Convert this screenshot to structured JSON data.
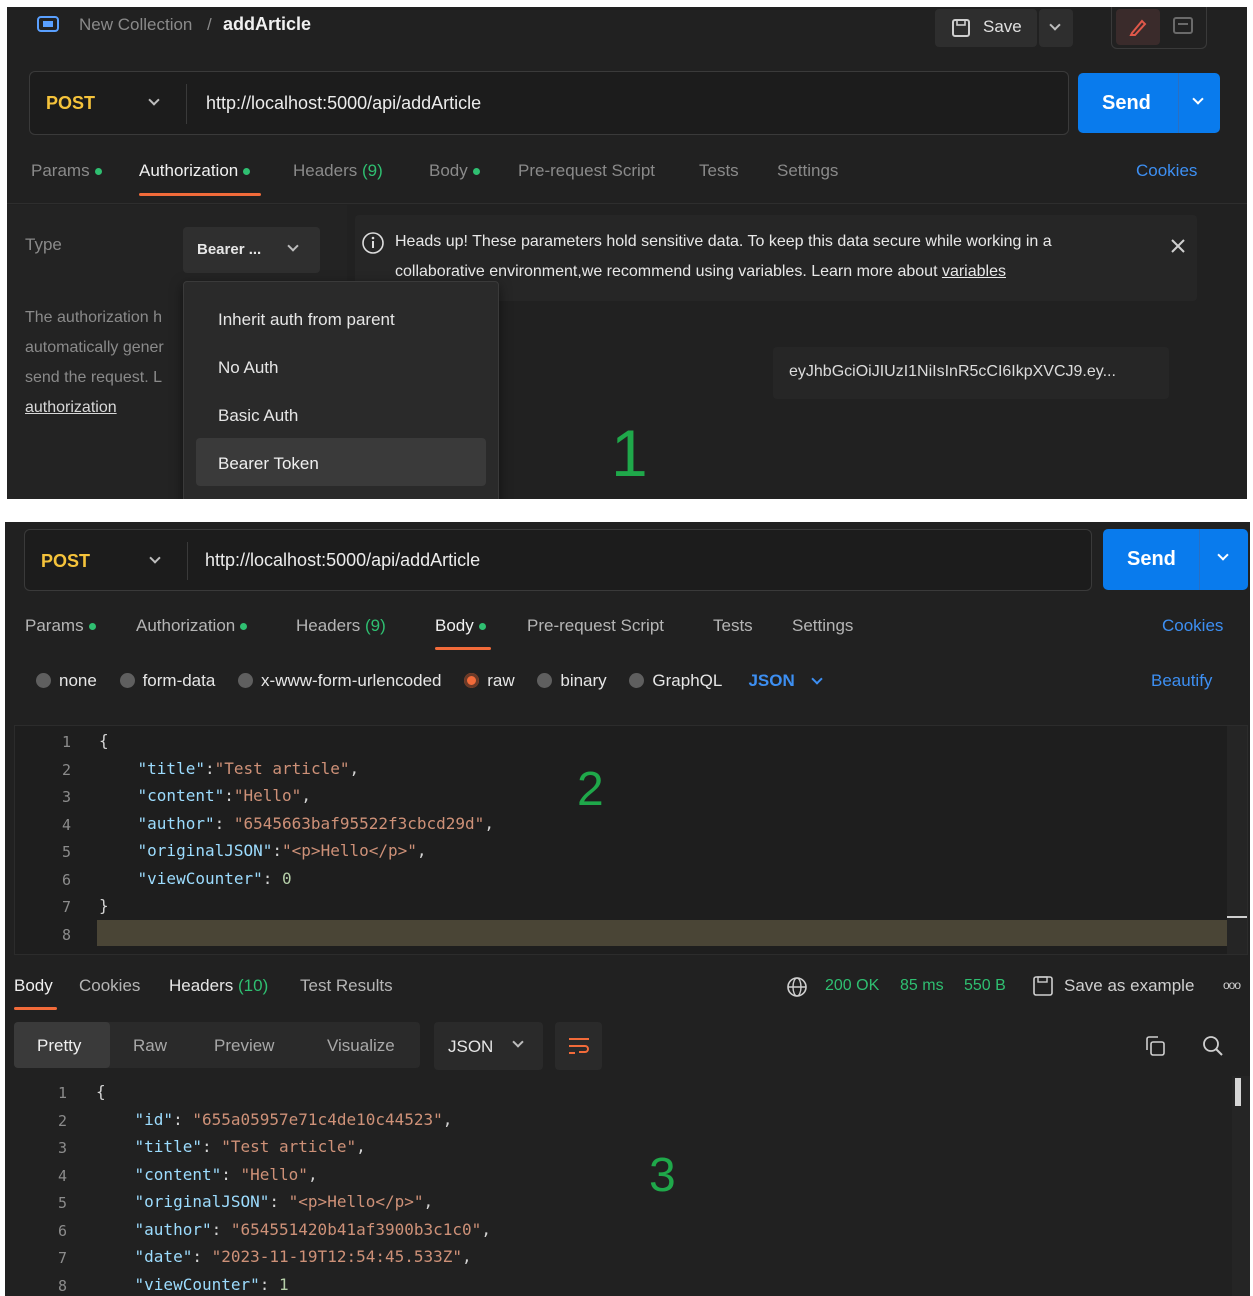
{
  "top": {
    "breadcrumb_parent": "New Collection",
    "breadcrumb_sep": "/",
    "request_name": "addArticle",
    "save_label": "Save",
    "method": "POST",
    "url": "http://localhost:5000/api/addArticle",
    "send_label": "Send",
    "tabs": [
      {
        "label": "Params",
        "dot": true
      },
      {
        "label": "Authorization",
        "dot": true
      },
      {
        "label": "Headers",
        "count": "(9)"
      },
      {
        "label": "Body",
        "dot": true
      },
      {
        "label": "Pre-request Script"
      },
      {
        "label": "Tests"
      },
      {
        "label": "Settings"
      }
    ],
    "cookies_label": "Cookies",
    "type_label": "Type",
    "type_value": "Bearer ...",
    "desc_lines": [
      "The authorization h",
      "automatically gener",
      "send the request. L"
    ],
    "desc_link": "authorization",
    "alert_line1": "Heads up! These parameters hold sensitive data. To keep this data secure while working in a",
    "alert_line2": "collaborative environment,we recommend using variables. Learn more about ",
    "alert_link": "variables",
    "token": "eyJhbGciOiJIUzI1NiIsInR5cCI6IkpXVCJ9.ey...",
    "dropdown": [
      "Inherit auth from parent",
      "No Auth",
      "Basic Auth",
      "Bearer Token"
    ],
    "marker": "1"
  },
  "bottom": {
    "method": "POST",
    "url": "http://localhost:5000/api/addArticle",
    "send_label": "Send",
    "tabs": [
      {
        "label": "Params",
        "dot": true
      },
      {
        "label": "Authorization",
        "dot": true
      },
      {
        "label": "Headers",
        "count": "(9)"
      },
      {
        "label": "Body",
        "dot": true
      },
      {
        "label": "Pre-request Script"
      },
      {
        "label": "Tests"
      },
      {
        "label": "Settings"
      }
    ],
    "cookies_label": "Cookies",
    "body_types": [
      "none",
      "form-data",
      "x-www-form-urlencoded",
      "raw",
      "binary",
      "GraphQL"
    ],
    "body_format": "JSON",
    "beautify_label": "Beautify",
    "request_lines": [
      "1",
      "2",
      "3",
      "4",
      "5",
      "6",
      "7",
      "8"
    ],
    "request_code": [
      "{",
      "    \"title\":\"Test article\",",
      "    \"content\":\"Hello\",",
      "    \"author\": \"6545663baf95522f3cbcd29d\",",
      "    \"originalJSON\":\"<p>Hello</p>\",",
      "    \"viewCounter\": 0",
      "}",
      ""
    ],
    "marker2": "2",
    "resp_tabs": [
      {
        "label": "Body"
      },
      {
        "label": "Cookies"
      },
      {
        "label": "Headers",
        "count": "(10)"
      },
      {
        "label": "Test Results"
      }
    ],
    "status": "200 OK",
    "time": "85 ms",
    "size": "550 B",
    "save_example": "Save as example",
    "more": "ooo",
    "view_tabs": [
      "Pretty",
      "Raw",
      "Preview",
      "Visualize"
    ],
    "view_format": "JSON",
    "response_lines": [
      "1",
      "2",
      "3",
      "4",
      "5",
      "6",
      "7",
      "8"
    ],
    "response_code": [
      "{",
      "    \"id\": \"655a05957e71c4de10c44523\",",
      "    \"title\": \"Test article\",",
      "    \"content\": \"Hello\",",
      "    \"originalJSON\": \"<p>Hello</p>\",",
      "    \"author\": \"654551420b41af3900b3c1c0\",",
      "    \"date\": \"2023-11-19T12:54:45.533Z\",",
      "    \"viewCounter\": 1"
    ],
    "marker3": "3"
  },
  "colors": {
    "accent": "#f26b3a",
    "send": "#097bed",
    "ok": "#2fbf71",
    "link": "#3d8ff2",
    "marker": "#1fa84a"
  }
}
